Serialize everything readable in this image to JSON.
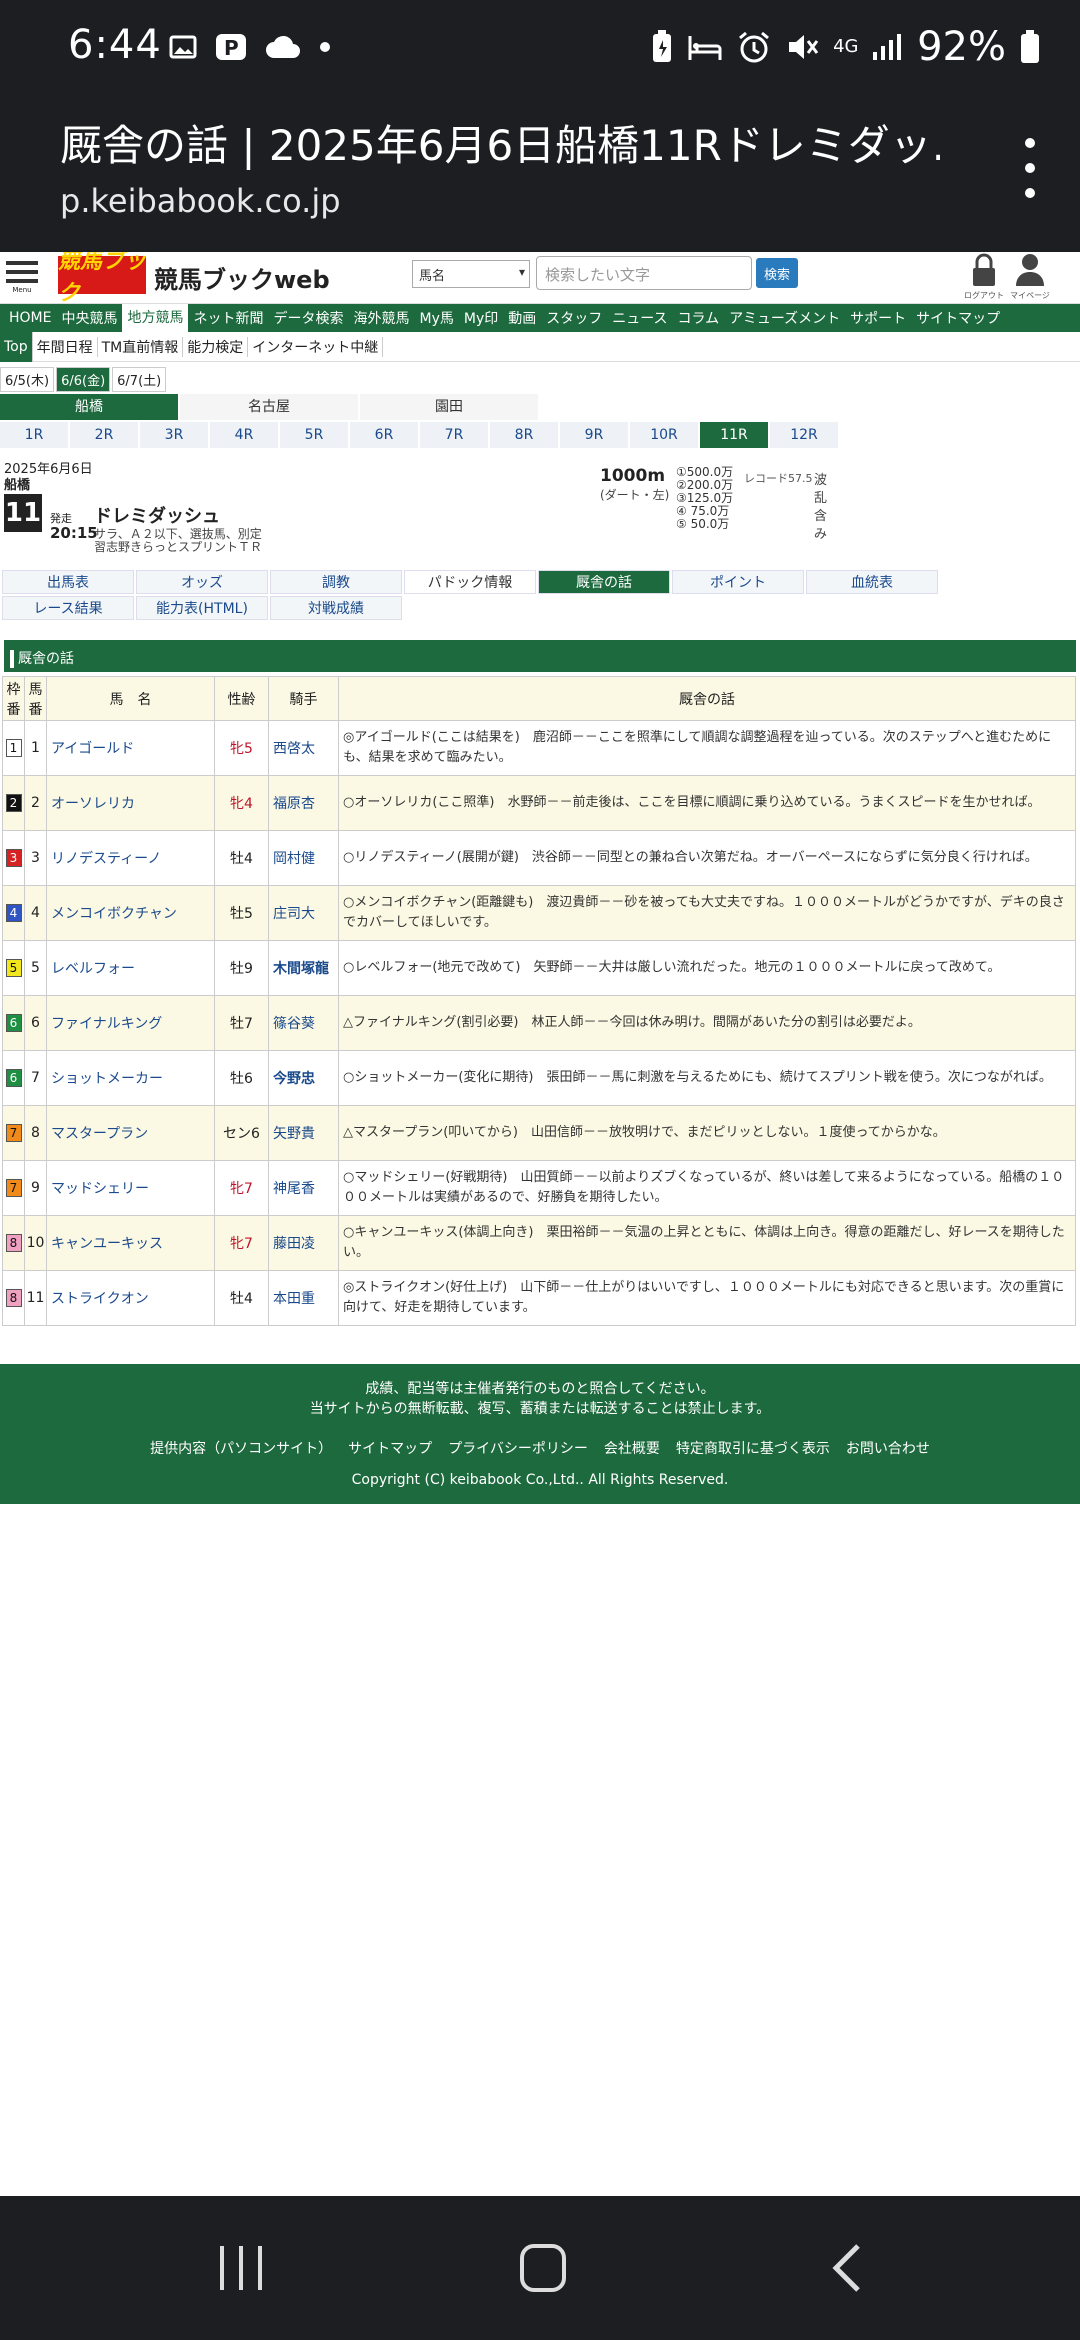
{
  "status": {
    "time": "6:44",
    "battery": "92%",
    "network": "4G"
  },
  "browser": {
    "title": "厩舎の話 | 2025年6月6日船橋11Rドレミダッ...",
    "url": "p.keibabook.co.jp"
  },
  "header": {
    "logo": "競馬ブック",
    "brand": "競馬ブックweb",
    "select_value": "馬名",
    "search_placeholder": "検索したい文字",
    "search_button": "検索",
    "menu_label": "Menu",
    "logout_label": "ログアウト",
    "mypage_label": "マイページ"
  },
  "nav1": [
    "HOME",
    "中央競馬",
    "地方競馬",
    "ネット新聞",
    "データ検索",
    "海外競馬",
    "My馬",
    "My印",
    "動画",
    "スタッフ",
    "ニュース",
    "コラム",
    "アミューズメント",
    "サポート",
    "サイトマップ"
  ],
  "nav2": [
    "Top",
    "年間日程",
    "TM直前情報",
    "能力検定",
    "インターネット中継"
  ],
  "dates": [
    "6/5(木)",
    "6/6(金)",
    "6/7(土)"
  ],
  "venues": [
    "船橋",
    "名古屋",
    "園田"
  ],
  "races": [
    "1R",
    "2R",
    "3R",
    "4R",
    "5R",
    "6R",
    "7R",
    "8R",
    "9R",
    "10R",
    "11R",
    "12R"
  ],
  "race": {
    "date": "2025年6月6日",
    "venue": "船橋",
    "number": "11",
    "start_label": "発走",
    "start_time": "20:15",
    "name": "ドレミダッシュ",
    "cond1": "サラ、Ａ２以下、選抜馬、別定",
    "cond2": "習志野きらっとスプリントＴＲ",
    "distance": "1000m",
    "track": "(ダート・左)",
    "prizes": [
      "①500.0万",
      "②200.0万",
      "③125.0万",
      "④ 75.0万",
      "⑤ 50.0万"
    ],
    "record": "レコード57.5",
    "side": [
      "波",
      "乱",
      "含",
      "み"
    ]
  },
  "tabs": [
    "出馬表",
    "オッズ",
    "調教",
    "パドック情報",
    "厩舎の話",
    "ポイント",
    "血統表",
    "レース結果",
    "能力表(HTML)",
    "対戦成績"
  ],
  "section_title": "厩舎の話",
  "table_headers": {
    "waku": "枠番",
    "uma": "馬番",
    "name": "馬　名",
    "sex": "性齢",
    "jockey": "騎手",
    "comment": "厩舎の話"
  },
  "entries": [
    {
      "waku": "1",
      "uma": "1",
      "name": "アイゴールド",
      "sex": "牝5",
      "jockey": "西啓太",
      "comment": "◎アイゴールド(ここは結果を)　鹿沼師－－ここを照準にして順調な調整過程を辿っている。次のステップへと進むためにも、結果を求めて臨みたい。"
    },
    {
      "waku": "2",
      "uma": "2",
      "name": "オーソレリカ",
      "sex": "牝4",
      "jockey": "福原杏",
      "comment": "○オーソレリカ(ここ照準)　水野師－－前走後は、ここを目標に順調に乗り込めている。うまくスピードを生かせれば。"
    },
    {
      "waku": "3",
      "uma": "3",
      "name": "リノデスティーノ",
      "sex": "牡4",
      "jockey": "岡村健",
      "comment": "○リノデスティーノ(展開が鍵)　渋谷師－－同型との兼ね合い次第だね。オーバーペースにならずに気分良く行ければ。"
    },
    {
      "waku": "4",
      "uma": "4",
      "name": "メンコイボクチャン",
      "sex": "牡5",
      "jockey": "庄司大",
      "comment": "○メンコイボクチャン(距離鍵も)　渡辺貴師－－砂を被っても大丈夫ですね。１０００メートルがどうかですが、デキの良さでカバーしてほしいです。"
    },
    {
      "waku": "5",
      "uma": "5",
      "name": "レベルフォー",
      "sex": "牡9",
      "jockey": "木間塚龍",
      "comment": "○レベルフォー(地元で改めて)　矢野師－－大井は厳しい流れだった。地元の１０００メートルに戻って改めて。"
    },
    {
      "waku": "6",
      "uma": "6",
      "name": "ファイナルキング",
      "sex": "牡7",
      "jockey": "篠谷葵",
      "comment": "△ファイナルキング(割引必要)　林正人師－－今回は休み明け。間隔があいた分の割引は必要だよ。"
    },
    {
      "waku": "6",
      "uma": "7",
      "name": "ショットメーカー",
      "sex": "牡6",
      "jockey": "今野忠",
      "comment": "○ショットメーカー(変化に期待)　張田師－－馬に刺激を与えるためにも、続けてスプリント戦を使う。次につながれば。"
    },
    {
      "waku": "7",
      "uma": "8",
      "name": "マスタープラン",
      "sex": "セン6",
      "jockey": "矢野貴",
      "comment": "△マスタープラン(叩いてから)　山田信師－－放牧明けで、まだピリッとしない。１度使ってからかな。"
    },
    {
      "waku": "7",
      "uma": "9",
      "name": "マッドシェリー",
      "sex": "牝7",
      "jockey": "神尾香",
      "comment": "○マッドシェリー(好戦期待)　山田質師－－以前よりズブくなっているが、終いは差して来るようになっている。船橋の１０００メートルは実績があるので、好勝負を期待したい。"
    },
    {
      "waku": "8",
      "uma": "10",
      "name": "キャンユーキッス",
      "sex": "牝7",
      "jockey": "藤田凌",
      "comment": "○キャンユーキッス(体調上向き)　栗田裕師－－気温の上昇とともに、体調は上向き。得意の距離だし、好レースを期待したい。"
    },
    {
      "waku": "8",
      "uma": "11",
      "name": "ストライクオン",
      "sex": "牡4",
      "jockey": "本田重",
      "comment": "◎ストライクオン(好仕上げ)　山下師－－仕上がりはいいですし、１０００メートルにも対応できると思います。次の重賞に向けて、好走を期待しています。"
    }
  ],
  "footer": {
    "line1": "成績、配当等は主催者発行のものと照合してください。",
    "line2": "当サイトからの無断転載、複写、蓄積または転送することは禁止します。",
    "links": [
      "提供内容（パソコンサイト）",
      "サイトマップ",
      "プライバシーポリシー",
      "会社概要",
      "特定商取引に基づく表示",
      "お問い合わせ"
    ],
    "copyright": "Copyright (C) keibabook Co.,Ltd.. All Rights Reserved."
  },
  "colors": {
    "green": "#1d6a3e",
    "waku": [
      "#ffffff",
      "#111111",
      "#d62222",
      "#2f55c4",
      "#f2e71c",
      "#1f8f43",
      "#f08a1a",
      "#f0a0c0"
    ]
  }
}
